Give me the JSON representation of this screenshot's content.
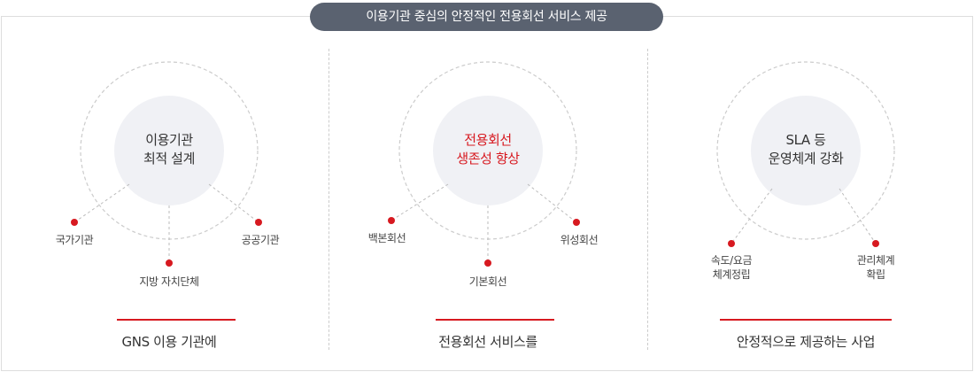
{
  "header": {
    "title": "이용기관 중심의 안정적인 전용회선 서비스 제공"
  },
  "columns": [
    {
      "center": [
        "이용기관",
        "최적 설계"
      ],
      "nodes": [
        {
          "label": [
            "국가기관"
          ]
        },
        {
          "label": [
            "지방 자치단체"
          ]
        },
        {
          "label": [
            "공공기관"
          ]
        }
      ],
      "caption": "GNS 이용 기관에"
    },
    {
      "center": [
        "전용회선",
        "생존성 향상"
      ],
      "nodes": [
        {
          "label": [
            "백본회선"
          ]
        },
        {
          "label": [
            "기본회선"
          ]
        },
        {
          "label": [
            "위성회선"
          ]
        }
      ],
      "caption": "전용회선 서비스를"
    },
    {
      "center": [
        "SLA 등",
        "운영체계 강화"
      ],
      "nodes": [
        {
          "label": [
            "속도/요금",
            "체계정립"
          ]
        },
        {
          "label": [
            "관리체계",
            "확립"
          ]
        }
      ],
      "caption": "안정적으로 제공하는 사업"
    }
  ],
  "colors": {
    "accent": "#d71920",
    "header_bg": "#5a6270",
    "inner_circle": "#f0f1f5",
    "dashed": "#cccccc"
  }
}
